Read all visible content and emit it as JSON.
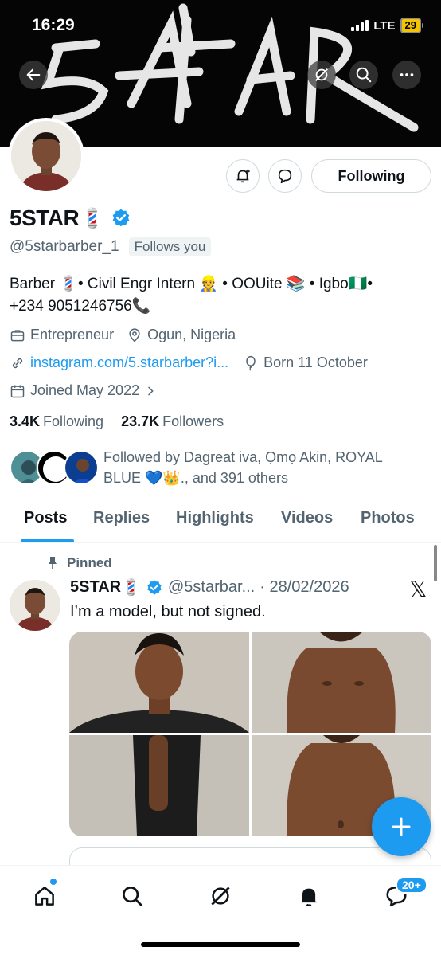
{
  "status_bar": {
    "time": "16:29",
    "network": "LTE",
    "battery": "29"
  },
  "banner": {
    "art_text": "5STAR"
  },
  "header_icons": [
    "back-arrow-icon",
    "grok-icon",
    "search-icon",
    "more-icon"
  ],
  "profile": {
    "name": "5STAR",
    "name_emoji": "💈",
    "handle": "@5starbarber_1",
    "follows_you": "Follows you",
    "following_button": "Following",
    "bio_line1": "Barber 💈• Civil Engr Intern 👷 • OOUite 📚 • Igbo🇳🇬•",
    "bio_line2": "+234 9051246756📞",
    "category": "Entrepreneur",
    "location": "Ogun, Nigeria",
    "link": "instagram.com/5.starbarber?i...",
    "birthday": "Born 11 October",
    "joined": "Joined May 2022",
    "following_count": "3.4K",
    "following_label": "Following",
    "followers_count": "23.7K",
    "followers_label": "Followers",
    "followed_by_line1": "Followed by Dagreat iva, Ọmọ Akin, ROYAL",
    "followed_by_line2": "BLUE 💙👑., and 391 others"
  },
  "tabs": [
    "Posts",
    "Replies",
    "Highlights",
    "Videos",
    "Photos"
  ],
  "post": {
    "pinned_label": "Pinned",
    "author": "5STAR",
    "author_emoji": "💈",
    "handle": "@5starbar...",
    "date": "· 28/02/2026",
    "source_logo": "𝕏",
    "text": "I’m a model, but not signed."
  },
  "bottom_nav": {
    "notifications_badge": "20+"
  },
  "colors": {
    "accent": "#1d9bf0",
    "text": "#0f1419",
    "muted": "#536471",
    "border": "#cfd9de"
  }
}
